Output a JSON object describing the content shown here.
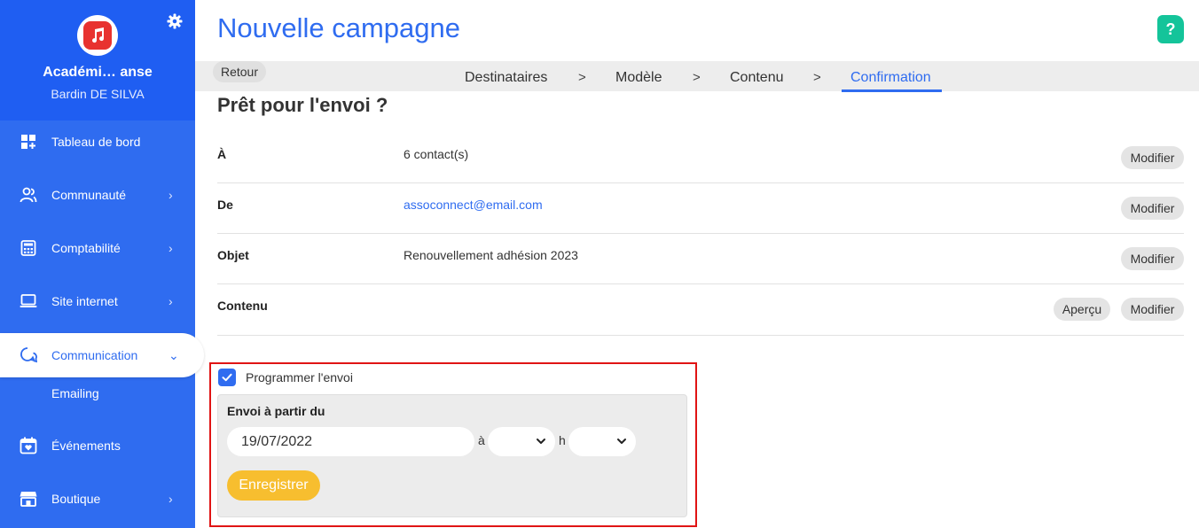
{
  "sidebar": {
    "org_name": "Académi… anse",
    "user_name": "Bardin DE SILVA",
    "items": [
      {
        "label": "Tableau de bord",
        "icon": "dashboard-icon",
        "chevron": ""
      },
      {
        "label": "Communauté",
        "icon": "people-icon",
        "chevron": "›"
      },
      {
        "label": "Comptabilité",
        "icon": "calculator-icon",
        "chevron": "›"
      },
      {
        "label": "Site internet",
        "icon": "laptop-icon",
        "chevron": "›"
      },
      {
        "label": "Communication",
        "icon": "chat-icon",
        "chevron": "⌄"
      },
      {
        "label": "Événements",
        "icon": "calendar-icon",
        "chevron": ""
      },
      {
        "label": "Boutique",
        "icon": "shop-icon",
        "chevron": "›"
      }
    ],
    "sub_item": "Emailing",
    "accent": "#2f6cf0"
  },
  "header": {
    "title": "Nouvelle campagne",
    "help": "?"
  },
  "steps": {
    "back": "Retour",
    "items": [
      "Destinataires",
      "Modèle",
      "Contenu",
      "Confirmation"
    ],
    "separator": ">",
    "current": "Confirmation"
  },
  "summary": {
    "title": "Prêt pour l'envoi ?",
    "rows": [
      {
        "label": "À",
        "value": "6 contact(s)",
        "action": "Modifier"
      },
      {
        "label": "De",
        "value": "assoconnect@email.com",
        "action": "Modifier"
      },
      {
        "label": "Objet",
        "value": "Renouvellement adhésion 2023",
        "action": "Modifier"
      },
      {
        "label": "Contenu",
        "value": "",
        "preview": "Aperçu",
        "action": "Modifier"
      }
    ]
  },
  "schedule": {
    "checkbox_label": "Programmer l'envoi",
    "checked": true,
    "panel_label": "Envoi à partir du",
    "date": "19/07/2022",
    "at": "à",
    "h": "h",
    "hour": "",
    "minute": "",
    "save": "Enregistrer"
  }
}
